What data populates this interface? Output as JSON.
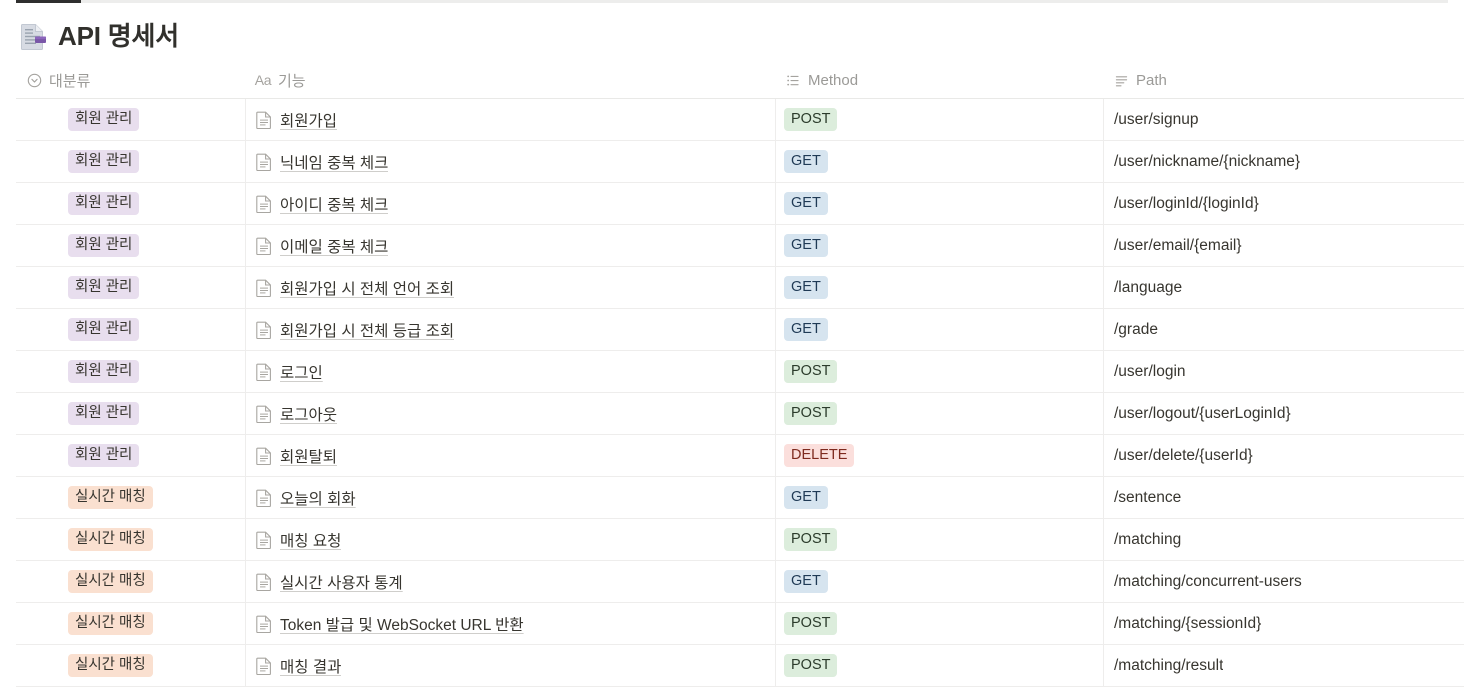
{
  "window": {
    "tab_indicator": "active-tab-underline"
  },
  "header": {
    "icon": "page-with-purple-marker-icon",
    "title": "API 명세서"
  },
  "table": {
    "columns": [
      {
        "key": "category",
        "label": "대분류",
        "icon": "select-property-icon"
      },
      {
        "key": "function",
        "label": "기능",
        "icon": "title-property-icon"
      },
      {
        "key": "method",
        "label": "Method",
        "icon": "multi-select-property-icon"
      },
      {
        "key": "path",
        "label": "Path",
        "icon": "text-property-icon"
      }
    ],
    "tag_colors": {
      "회원 관리": {
        "bg": "#E8DEEE",
        "fg": "#37352F"
      },
      "실시간 매칭": {
        "bg": "#FAE0D0",
        "fg": "#37352F"
      }
    },
    "method_colors": {
      "GET": {
        "bg": "#D6E4EF",
        "fg": "#1F3A55"
      },
      "POST": {
        "bg": "#DCEDDC",
        "fg": "#2B3B2B"
      },
      "DELETE": {
        "bg": "#FBDFDC",
        "fg": "#7E2A1E"
      }
    },
    "rows": [
      {
        "category": "회원 관리",
        "function": "회원가입",
        "method": "POST",
        "path": "/user/signup"
      },
      {
        "category": "회원 관리",
        "function": "닉네임 중복 체크",
        "method": "GET",
        "path": "/user/nickname/{nickname}"
      },
      {
        "category": "회원 관리",
        "function": "아이디 중복 체크",
        "method": "GET",
        "path": "/user/loginId/{loginId}"
      },
      {
        "category": "회원 관리",
        "function": "이메일 중복 체크",
        "method": "GET",
        "path": "/user/email/{email}"
      },
      {
        "category": "회원 관리",
        "function": "회원가입 시 전체 언어 조회",
        "method": "GET",
        "path": "/language"
      },
      {
        "category": "회원 관리",
        "function": "회원가입 시 전체 등급 조회",
        "method": "GET",
        "path": "/grade"
      },
      {
        "category": "회원 관리",
        "function": "로그인",
        "method": "POST",
        "path": "/user/login"
      },
      {
        "category": "회원 관리",
        "function": "로그아웃",
        "method": "POST",
        "path": "/user/logout/{userLoginId}"
      },
      {
        "category": "회원 관리",
        "function": "회원탈퇴",
        "method": "DELETE",
        "path": "/user/delete/{userId}"
      },
      {
        "category": "실시간 매칭",
        "function": "오늘의 회화",
        "method": "GET",
        "path": "/sentence"
      },
      {
        "category": "실시간 매칭",
        "function": "매칭 요청",
        "method": "POST",
        "path": "/matching"
      },
      {
        "category": "실시간 매칭",
        "function": "실시간 사용자 통계",
        "method": "GET",
        "path": "/matching/concurrent-users"
      },
      {
        "category": "실시간 매칭",
        "function": "Token 발급 및 WebSocket URL 반환",
        "method": "POST",
        "path": "/matching/{sessionId}"
      },
      {
        "category": "실시간 매칭",
        "function": "매칭 결과",
        "method": "POST",
        "path": "/matching/result"
      }
    ]
  }
}
